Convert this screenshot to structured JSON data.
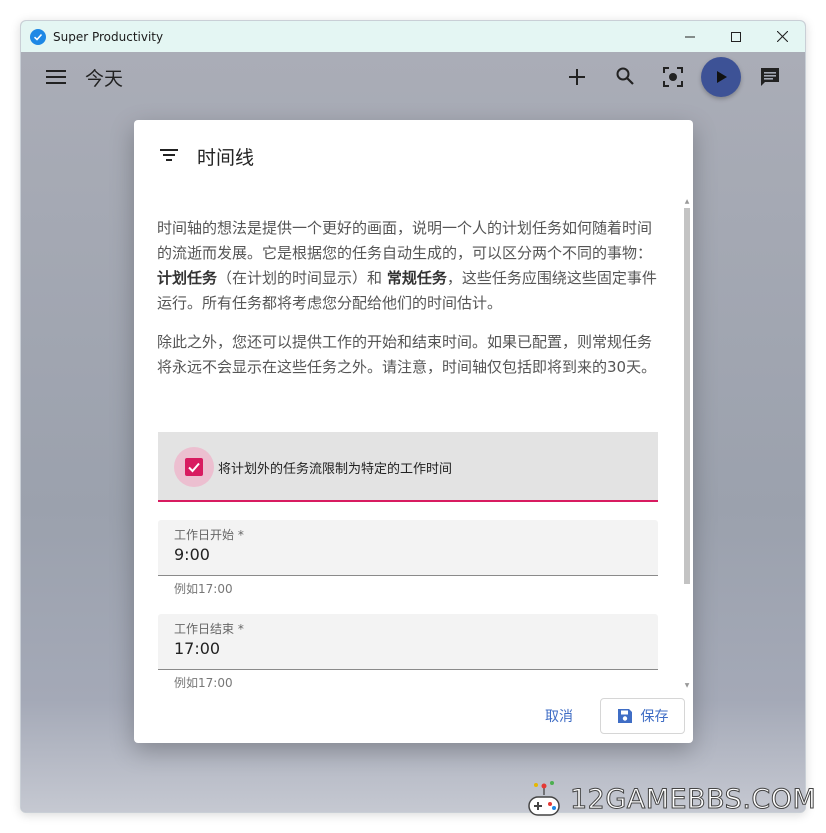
{
  "window": {
    "title": "Super Productivity",
    "controls": [
      "minimize-icon",
      "maximize-icon",
      "close-icon"
    ]
  },
  "toolbar": {
    "title": "今天",
    "icons": [
      "menu-icon",
      "add-icon",
      "search-icon",
      "focus-icon",
      "play-icon",
      "chat-icon"
    ],
    "accent_color": "#3d5296"
  },
  "dialog": {
    "title": "时间线",
    "paragraph1": {
      "part1": "时间轴的想法是提供一个更好的画面，说明一个人的计划任务如何随着时间的流逝而发展。它是根据您的任务自动生成的，可以区分两个不同的事物：",
      "bold1": "计划任务",
      "part2": "（在计划的时间显示）和",
      "bold2": "常规任务",
      "part3": "，这些任务应围绕这些固定事件运行。所有任务都将考虑您分配给他们的时间估计。"
    },
    "paragraph2": "除此之外，您还可以提供工作的开始和结束时间。如果已配置，则常规任务将永远不会显示在这些任务之外。请注意，时间轴仅包括即将到来的30天。",
    "checkbox": {
      "label": "将计划外的任务流限制为特定的工作时间",
      "checked": true,
      "color": "#d81b60"
    },
    "fields": [
      {
        "label": "工作日开始 *",
        "value": "9:00",
        "hint": "例如17:00"
      },
      {
        "label": "工作日结束 *",
        "value": "17:00",
        "hint": "例如17:00"
      }
    ],
    "actions": {
      "cancel": "取消",
      "save": "保存"
    }
  },
  "watermark": "12GAMEBBS.COM"
}
